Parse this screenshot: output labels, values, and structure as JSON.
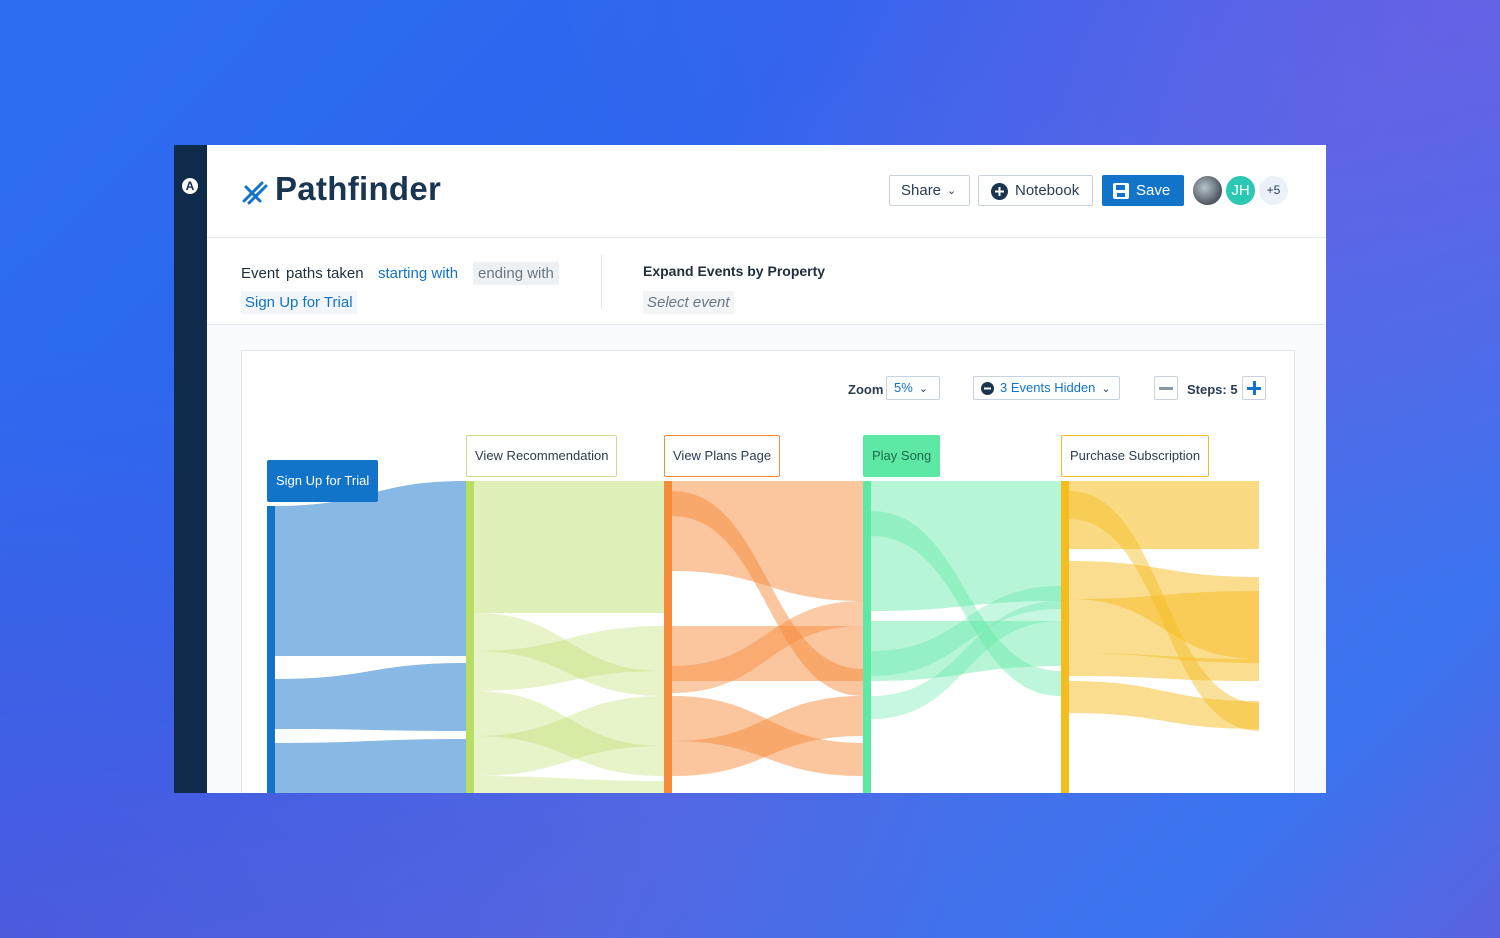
{
  "app": {
    "title": "Pathfinder",
    "logo_icon": "amplitude-logo-icon",
    "title_icon": "pathfinder-icon",
    "buttons": {
      "share": "Share",
      "notebook": "Notebook",
      "save": "Save"
    },
    "avatars": {
      "initials": "JH",
      "more": "+5"
    }
  },
  "query": {
    "event_label": "Event",
    "paths_label": "paths taken",
    "starting_with": "starting with",
    "ending_with": "ending with",
    "start_event": "Sign Up for Trial",
    "expand_title": "Expand Events by Property",
    "select_placeholder": "Select event"
  },
  "controls": {
    "zoom_label": "Zoom",
    "zoom_value": "5%",
    "hidden_label": "3 Events Hidden",
    "steps_label": "Steps: 5"
  },
  "colors": {
    "accent": "#1274c9",
    "rail": "#0f2b4c",
    "step1": "#1274c9",
    "step2": "#b9de63",
    "step3": "#f78c3b",
    "step4": "#5de8a5",
    "step5": "#f5bc1e"
  },
  "chart_data": {
    "type": "sankey",
    "steps": [
      "Sign Up for Trial",
      "View Recommendation",
      "View Plans Page",
      "Play Song",
      "Purchase Subscription"
    ]
  }
}
